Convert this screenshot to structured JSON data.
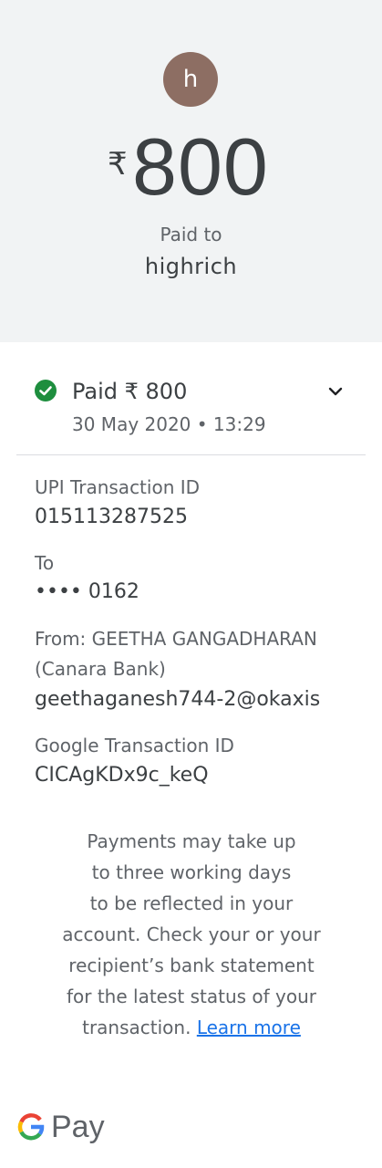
{
  "header": {
    "avatar_initial": "h",
    "currency_symbol": "₹",
    "amount": "800",
    "paid_to_label": "Paid to",
    "payee_name": "highrich"
  },
  "status": {
    "title": "Paid ₹ 800",
    "datetime": "30 May 2020 • 13:29",
    "icon": "check-circle-icon",
    "expand_icon": "chevron-down-icon",
    "color": "#1e8e3e"
  },
  "details": {
    "upi_label": "UPI Transaction ID",
    "upi_value": "015113287525",
    "to_label": "To",
    "to_value": "•••• 0162",
    "from_line1": "From: GEETHA GANGADHARAN",
    "from_line2": "(Canara Bank)",
    "from_vpa": "geethaganesh744-2@okaxis",
    "google_label": "Google Transaction ID",
    "google_value": "CICAgKDx9c_keQ"
  },
  "note": {
    "lines": [
      "Payments may take up",
      "to three working days",
      "to be reflected in your",
      "account. Check your or your",
      "recipient’s bank statement",
      "for the latest status of your"
    ],
    "last_line_prefix": "transaction.",
    "link_text": "Learn more"
  },
  "footer": {
    "brand": "Pay",
    "icon": "google-g-icon"
  }
}
